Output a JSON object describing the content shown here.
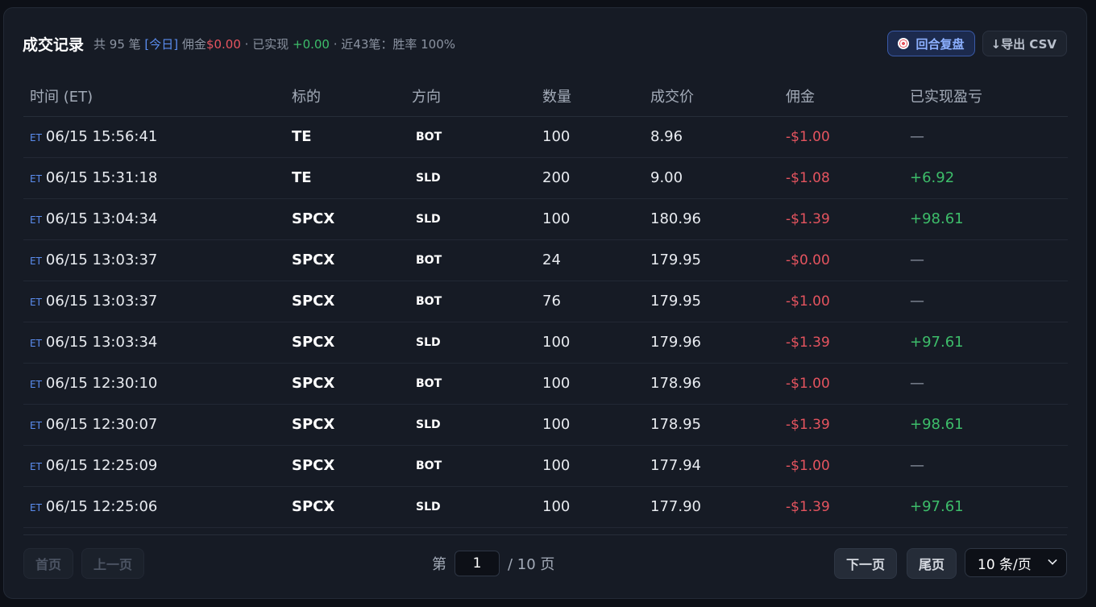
{
  "header": {
    "title": "成交记录",
    "count": "共 95 笔",
    "today": "[今日]",
    "commission_label": "佣金",
    "commission_value": "$0.00",
    "realized_label": "· 已实现",
    "realized_value": "+0.00",
    "winrate": "· 近43笔：胜率 100%",
    "replay_button": "回合复盘",
    "export_button": "↓导出 CSV"
  },
  "columns": [
    "时间 (ET)",
    "标的",
    "方向",
    "数量",
    "成交价",
    "佣金",
    "已实现盈亏"
  ],
  "rows": [
    {
      "tz": "ET",
      "time": "06/15 15:56:41",
      "symbol": "TE",
      "side": "BOT",
      "qty": "100",
      "price": "8.96",
      "commission": "-$1.00",
      "pnl": "—"
    },
    {
      "tz": "ET",
      "time": "06/15 15:31:18",
      "symbol": "TE",
      "side": "SLD",
      "qty": "200",
      "price": "9.00",
      "commission": "-$1.08",
      "pnl": "+6.92"
    },
    {
      "tz": "ET",
      "time": "06/15 13:04:34",
      "symbol": "SPCX",
      "side": "SLD",
      "qty": "100",
      "price": "180.96",
      "commission": "-$1.39",
      "pnl": "+98.61"
    },
    {
      "tz": "ET",
      "time": "06/15 13:03:37",
      "symbol": "SPCX",
      "side": "BOT",
      "qty": "24",
      "price": "179.95",
      "commission": "-$0.00",
      "pnl": "—"
    },
    {
      "tz": "ET",
      "time": "06/15 13:03:37",
      "symbol": "SPCX",
      "side": "BOT",
      "qty": "76",
      "price": "179.95",
      "commission": "-$1.00",
      "pnl": "—"
    },
    {
      "tz": "ET",
      "time": "06/15 13:03:34",
      "symbol": "SPCX",
      "side": "SLD",
      "qty": "100",
      "price": "179.96",
      "commission": "-$1.39",
      "pnl": "+97.61"
    },
    {
      "tz": "ET",
      "time": "06/15 12:30:10",
      "symbol": "SPCX",
      "side": "BOT",
      "qty": "100",
      "price": "178.96",
      "commission": "-$1.00",
      "pnl": "—"
    },
    {
      "tz": "ET",
      "time": "06/15 12:30:07",
      "symbol": "SPCX",
      "side": "SLD",
      "qty": "100",
      "price": "178.95",
      "commission": "-$1.39",
      "pnl": "+98.61"
    },
    {
      "tz": "ET",
      "time": "06/15 12:25:09",
      "symbol": "SPCX",
      "side": "BOT",
      "qty": "100",
      "price": "177.94",
      "commission": "-$1.00",
      "pnl": "—"
    },
    {
      "tz": "ET",
      "time": "06/15 12:25:06",
      "symbol": "SPCX",
      "side": "SLD",
      "qty": "100",
      "price": "177.90",
      "commission": "-$1.39",
      "pnl": "+97.61"
    }
  ],
  "pagination": {
    "first": "首页",
    "prev": "上一页",
    "page_prefix": "第",
    "current_page": "1",
    "page_suffix": "/ 10 页",
    "next": "下一页",
    "last": "尾页",
    "page_size": "10 条/页"
  },
  "colors": {
    "negative": "#e5545f",
    "positive": "#3dbd6a",
    "accent": "#5b8def"
  },
  "icons": {
    "replay": "target-icon",
    "select": "chevron-down-icon"
  }
}
